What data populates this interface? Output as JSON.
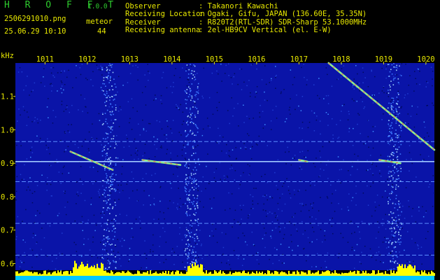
{
  "app": {
    "title": "H R O F F T",
    "version": "1.0.0"
  },
  "file": {
    "name": "2506291010.png",
    "timestamp": "25.06.29 10:10"
  },
  "meteor": {
    "label": "meteor",
    "count": "44"
  },
  "info": [
    {
      "key": "Observer",
      "value": ": Takanori Kawachi"
    },
    {
      "key": "Receiving Location",
      "value": ": Ogaki, Gifu, JAPAN (136.60E, 35.35N)"
    },
    {
      "key": "Receiver",
      "value": ": R820T2(RTL-SDR) SDR-Sharp 53.1000MHz"
    },
    {
      "key": "Receiving antenna",
      "value": ": 2el-HB9CV Vertical (el. E-W)"
    }
  ],
  "colors": {
    "background": "#000000",
    "label": "#e8e800",
    "title": "#2ecc2e",
    "noise": "#0a14a8",
    "carrier": "#a0c8ff",
    "level_bar": "#ffff00",
    "level_base": "#00c8ff"
  },
  "chart_data": {
    "type": "heatmap",
    "y_unit_label": "kHz",
    "x_ticks": [
      "1011",
      "1012",
      "1013",
      "1014",
      "1015",
      "1016",
      "1017",
      "1018",
      "1019",
      "1020"
    ],
    "y_ticks": [
      "1.1",
      "1.0",
      "0.9",
      "0.8",
      "0.7",
      "0.6"
    ],
    "ylim": [
      0.58,
      1.2
    ],
    "xlim": [
      1010.3,
      1020.2
    ],
    "carrier_lines_khz": [
      0.965,
      0.905,
      0.845,
      0.72,
      0.625
    ],
    "bright_columns_s": [
      1012.5,
      1014.45,
      1019.25
    ],
    "meteor_echoes": [
      {
        "x_start": 1011.6,
        "x_end": 1012.6,
        "y_start": 0.935,
        "y_end": 0.88
      },
      {
        "x_start": 1013.3,
        "x_end": 1014.2,
        "y_start": 0.91,
        "y_end": 0.895
      },
      {
        "x_start": 1017.0,
        "x_end": 1017.2,
        "y_start": 0.91,
        "y_end": 0.905
      },
      {
        "x_start": 1018.9,
        "x_end": 1019.4,
        "y_start": 0.91,
        "y_end": 0.9
      },
      {
        "x_start": 1017.7,
        "x_end": 1020.2,
        "y_start": 1.2,
        "y_end": 0.94
      }
    ]
  }
}
